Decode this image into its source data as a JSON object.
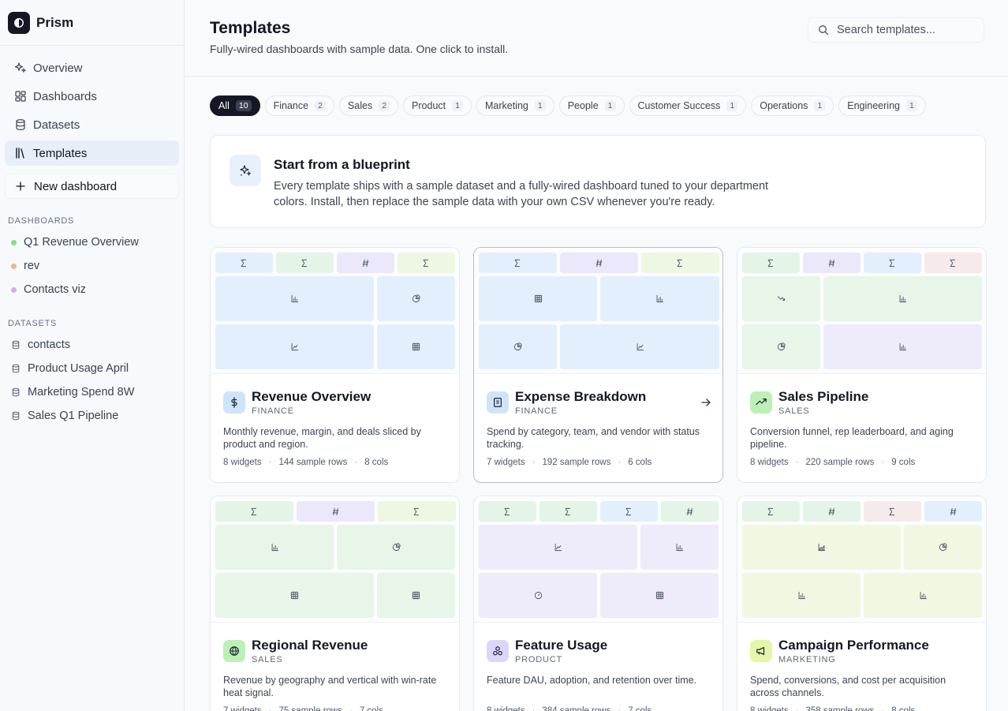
{
  "app": {
    "name": "Prism"
  },
  "nav": [
    {
      "label": "Overview",
      "icon": "sparkle-icon",
      "active": false
    },
    {
      "label": "Dashboards",
      "icon": "dashboard-icon",
      "active": false
    },
    {
      "label": "Datasets",
      "icon": "database-icon",
      "active": false
    },
    {
      "label": "Templates",
      "icon": "library-icon",
      "active": true
    }
  ],
  "new_dashboard_label": "New dashboard",
  "dashboards_section": {
    "title": "DASHBOARDS",
    "items": [
      {
        "label": "Q1 Revenue Overview",
        "color": "#86e07c"
      },
      {
        "label": "rev",
        "color": "#f5b384"
      },
      {
        "label": "Contacts viz",
        "color": "#dca6ef"
      }
    ]
  },
  "datasets_section": {
    "title": "DATASETS",
    "items": [
      {
        "label": "contacts"
      },
      {
        "label": "Product Usage April"
      },
      {
        "label": "Marketing Spend 8W"
      },
      {
        "label": "Sales Q1 Pipeline"
      }
    ]
  },
  "header": {
    "title": "Templates",
    "subtitle": "Fully-wired dashboards with sample data. One click to install.",
    "search_placeholder": "Search templates..."
  },
  "filters": [
    {
      "label": "All",
      "count": "10",
      "active": true
    },
    {
      "label": "Finance",
      "count": "2"
    },
    {
      "label": "Sales",
      "count": "2"
    },
    {
      "label": "Product",
      "count": "1"
    },
    {
      "label": "Marketing",
      "count": "1"
    },
    {
      "label": "People",
      "count": "1"
    },
    {
      "label": "Customer Success",
      "count": "1"
    },
    {
      "label": "Operations",
      "count": "1"
    },
    {
      "label": "Engineering",
      "count": "1"
    }
  ],
  "blueprint": {
    "title": "Start from a blueprint",
    "description": "Every template ships with a sample dataset and a fully-wired dashboard tuned to your department colors. Install, then replace the sample data with your own CSV whenever you're ready."
  },
  "colors": {
    "blue": "#e3effc",
    "green": "#e4f4e6",
    "purple": "#ebe8fb",
    "lime": "#eef7e2",
    "peach": "#f7eaea",
    "sales_light": "#e8f5e9",
    "product_light": "#eeebfb",
    "marketing_light": "#f1f8e2"
  },
  "templates": [
    {
      "title": "Revenue Overview",
      "category": "FINANCE",
      "description": "Monthly revenue, margin, and deals sliced by product and region.",
      "widgets": "8 widgets",
      "rows": "144 sample rows",
      "cols": "8 cols",
      "icon": "dollar-icon",
      "icon_bg": "#cfe3fb",
      "layout": "revenue"
    },
    {
      "title": "Expense Breakdown",
      "category": "FINANCE",
      "description": "Spend by category, team, and vendor with status tracking.",
      "widgets": "7 widgets",
      "rows": "192 sample rows",
      "cols": "6 cols",
      "icon": "receipt-icon",
      "icon_bg": "#cfe3fb",
      "layout": "expense"
    },
    {
      "title": "Sales Pipeline",
      "category": "SALES",
      "description": "Conversion funnel, rep leaderboard, and aging pipeline.",
      "widgets": "8 widgets",
      "rows": "220 sample rows",
      "cols": "9 cols",
      "icon": "trending-up-icon",
      "icon_bg": "#bdf0b6",
      "layout": "pipeline"
    },
    {
      "title": "Regional Revenue",
      "category": "SALES",
      "description": "Revenue by geography and vertical with win-rate heat signal.",
      "widgets": "7 widgets",
      "rows": "75 sample rows",
      "cols": "7 cols",
      "icon": "globe-icon",
      "icon_bg": "#bdf0b6",
      "layout": "regional"
    },
    {
      "title": "Feature Usage",
      "category": "PRODUCT",
      "description": "Feature DAU, adoption, and retention over time.",
      "widgets": "8 widgets",
      "rows": "384 sample rows",
      "cols": "7 cols",
      "icon": "shapes-icon",
      "icon_bg": "#ddd6fb",
      "layout": "feature"
    },
    {
      "title": "Campaign Performance",
      "category": "MARKETING",
      "description": "Spend, conversions, and cost per acquisition across channels.",
      "widgets": "8 widgets",
      "rows": "358 sample rows",
      "cols": "8 cols",
      "icon": "megaphone-icon",
      "icon_bg": "#e4f6a9",
      "layout": "campaign"
    }
  ]
}
